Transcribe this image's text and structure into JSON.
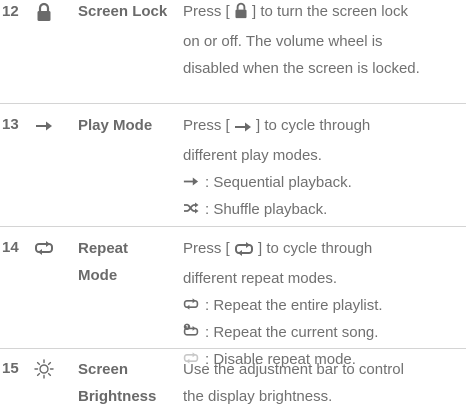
{
  "rows": [
    {
      "number": "12",
      "icon": "lock-icon",
      "name": "Screen Lock",
      "desc": {
        "line1_pre": "Press [ ",
        "line1_post": " ] to turn the screen lock",
        "line2": "on or off. The volume wheel is",
        "line3": "disabled when the screen is locked."
      }
    },
    {
      "number": "13",
      "icon": "right-arrow-icon",
      "name": "Play Mode",
      "desc": {
        "line1_pre": "Press [ ",
        "line1_post": " ] to cycle through",
        "line2": "different play modes.",
        "sub1": ": Sequential playback.",
        "sub2": ": Shuffle playback."
      }
    },
    {
      "number": "14",
      "icon": "repeat-icon",
      "name_line1": "Repeat",
      "name_line2": "Mode",
      "desc": {
        "line1_pre": "Press [ ",
        "line1_post": " ] to cycle through",
        "line2": "different repeat modes.",
        "sub1": ": Repeat the entire playlist.",
        "sub2": ": Repeat the current song.",
        "sub3": ": Disable repeat mode."
      }
    },
    {
      "number": "15",
      "icon": "brightness-icon",
      "name_line1": "Screen",
      "name_line2": "Brightness",
      "desc": {
        "line1": "Use the adjustment bar to control",
        "line2": "the display brightness."
      }
    }
  ],
  "colors": {
    "text": "#707070",
    "icon": "#6a6a6a",
    "icon_disabled": "#c8c8c8",
    "divider": "#d4d4d4"
  }
}
